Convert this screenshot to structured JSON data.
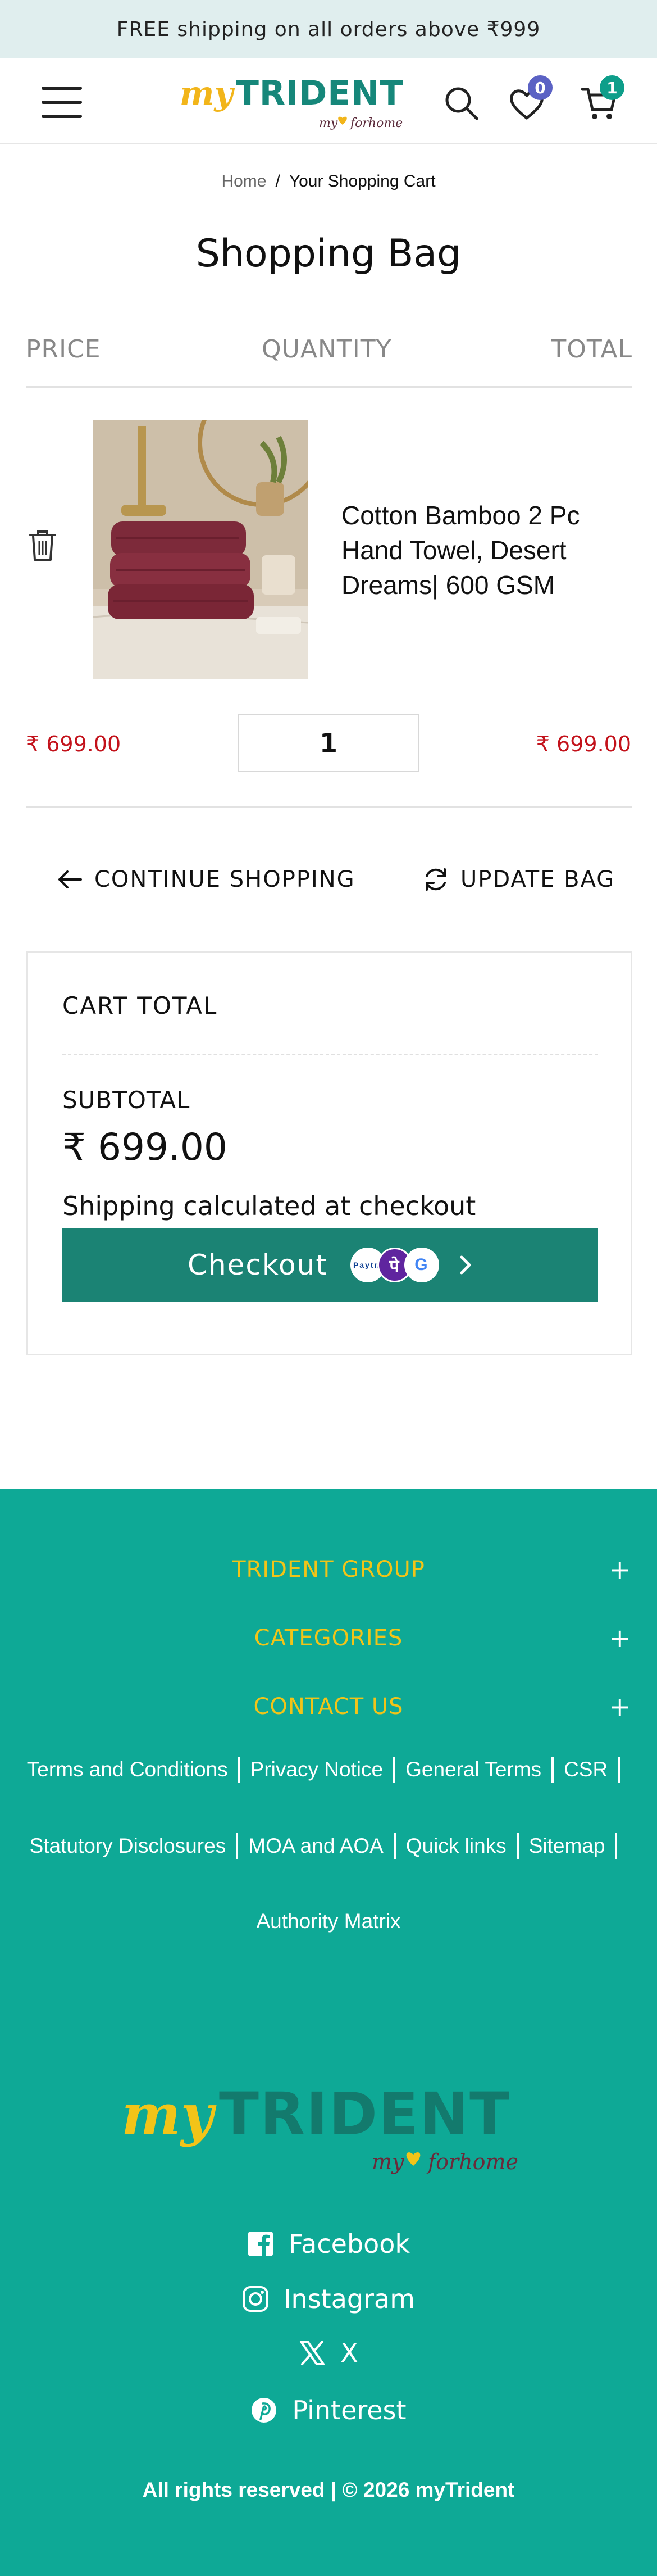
{
  "announcement": {
    "text": "FREE shipping on all orders above ₹999"
  },
  "header": {
    "logo_main": "myTRIDENT",
    "logo_my": "my",
    "logo_for_home": "forhome",
    "wishlist_count": "0",
    "cart_count": "1"
  },
  "breadcrumb": {
    "home": "Home",
    "separator": "/",
    "current": "Your Shopping Cart"
  },
  "page": {
    "title": "Shopping Bag"
  },
  "columns": {
    "price": "PRICE",
    "quantity": "QUANTITY",
    "total": "TOTAL"
  },
  "cart_item": {
    "name": "Cotton Bamboo 2 Pc Hand Towel, Desert Dreams| 600 GSM",
    "price": "₹ 699.00",
    "quantity": "1",
    "total": "₹ 699.00"
  },
  "actions": {
    "continue": "CONTINUE SHOPPING",
    "update": "UPDATE BAG"
  },
  "cart_total": {
    "title": "CART TOTAL",
    "subtotal_label": "SUBTOTAL",
    "subtotal_value": "₹ 699.00",
    "shipping_note": "Shipping calculated at checkout",
    "checkout_label": "Checkout",
    "pay_paytm": "Paytm",
    "pay_phonepe": "पे",
    "pay_gpay": "G"
  },
  "footer": {
    "accordions": [
      "TRIDENT GROUP",
      "CATEGORIES",
      "CONTACT US"
    ],
    "links_row1": [
      "Terms and Conditions",
      "Privacy Notice",
      "General Terms",
      "CSR"
    ],
    "links_row2": [
      "Statutory Disclosures",
      "MOA and AOA",
      "Quick links",
      "Sitemap"
    ],
    "links_row3": [
      "Authority Matrix"
    ],
    "logo_main": "myTRIDENT",
    "logo_my": "my",
    "logo_for_home": "forhome",
    "social": [
      "Facebook",
      "Instagram",
      "X",
      "Pinterest"
    ],
    "copyright": "All rights reserved | © 2026 myTrident"
  },
  "colors": {
    "brand_teal": "#0ea996",
    "checkout_green": "#1b8374",
    "price_red": "#c3121b",
    "logo_yellow": "#f2b51a",
    "badge_purple": "#5b62c4",
    "badge_teal": "#0e9e8a"
  }
}
